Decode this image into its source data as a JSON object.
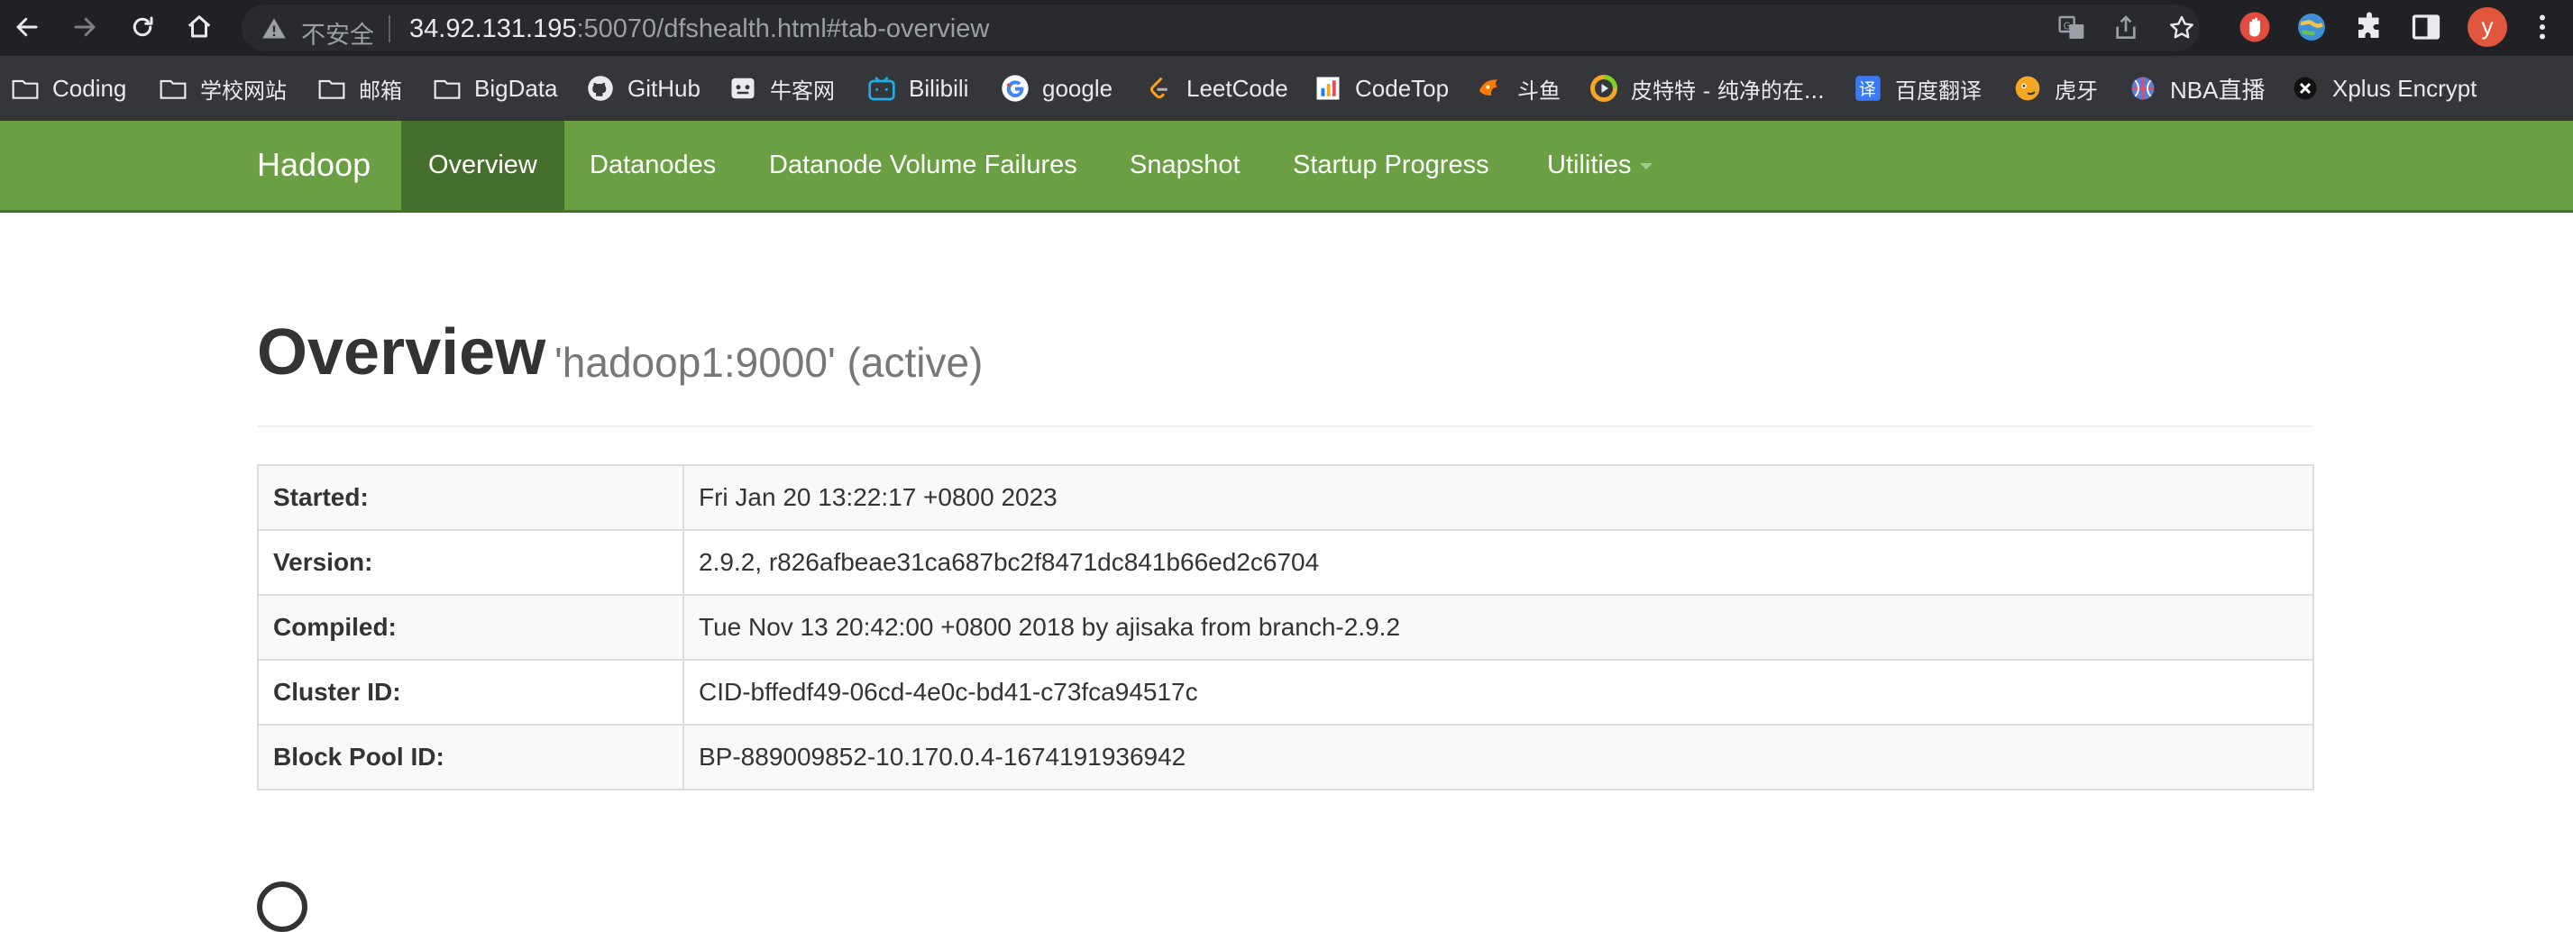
{
  "browser": {
    "security_label": "不安全",
    "url_host": "34.92.131.195",
    "url_rest": ":50070/dfshealth.html#tab-overview",
    "profile_initial": "y",
    "colors": {
      "avatar": "#e2563d",
      "tabbar": "#202124",
      "bookmarks_bar": "#35363a"
    }
  },
  "bookmarks": [
    {
      "label": "Coding",
      "icon": "folder-icon"
    },
    {
      "label": "学校网站",
      "icon": "folder-icon"
    },
    {
      "label": "邮箱",
      "icon": "folder-icon"
    },
    {
      "label": "BigData",
      "icon": "folder-icon"
    },
    {
      "label": "GitHub",
      "icon": "github-icon"
    },
    {
      "label": "牛客网",
      "icon": "nowcoder-icon"
    },
    {
      "label": "Bilibili",
      "icon": "bilibili-icon"
    },
    {
      "label": "google",
      "icon": "google-icon"
    },
    {
      "label": "LeetCode",
      "icon": "leetcode-icon"
    },
    {
      "label": "CodeTop",
      "icon": "codetop-icon"
    },
    {
      "label": "斗鱼",
      "icon": "douyu-icon"
    },
    {
      "label": "皮特特 - 纯净的在...",
      "icon": "pitt-icon"
    },
    {
      "label": "百度翻译",
      "icon": "baidu-translate-icon"
    },
    {
      "label": "虎牙",
      "icon": "huya-icon"
    },
    {
      "label": "NBA直播",
      "icon": "nba-icon"
    },
    {
      "label": "Xplus Encrypt",
      "icon": "xplus-icon"
    }
  ],
  "navbar": {
    "brand": "Hadoop",
    "links": [
      {
        "label": "Overview",
        "active": true
      },
      {
        "label": "Datanodes"
      },
      {
        "label": "Datanode Volume Failures"
      },
      {
        "label": "Snapshot"
      },
      {
        "label": "Startup Progress"
      },
      {
        "label": "Utilities",
        "dropdown": true
      }
    ],
    "colors": {
      "bar": "#6a9f43",
      "active": "#466e2c"
    }
  },
  "overview": {
    "title": "Overview",
    "subtitle": "'hadoop1:9000' (active)",
    "rows": [
      {
        "key": "Started:",
        "value": "Fri Jan 20 13:22:17 +0800 2023"
      },
      {
        "key": "Version:",
        "value": "2.9.2, r826afbeae31ca687bc2f8471dc841b66ed2c6704"
      },
      {
        "key": "Compiled:",
        "value": "Tue Nov 13 20:42:00 +0800 2018 by ajisaka from branch-2.9.2"
      },
      {
        "key": "Cluster ID:",
        "value": "CID-bffedf49-06cd-4e0c-bd41-c73fca94517c"
      },
      {
        "key": "Block Pool ID:",
        "value": "BP-889009852-10.170.0.4-1674191936942"
      }
    ]
  }
}
